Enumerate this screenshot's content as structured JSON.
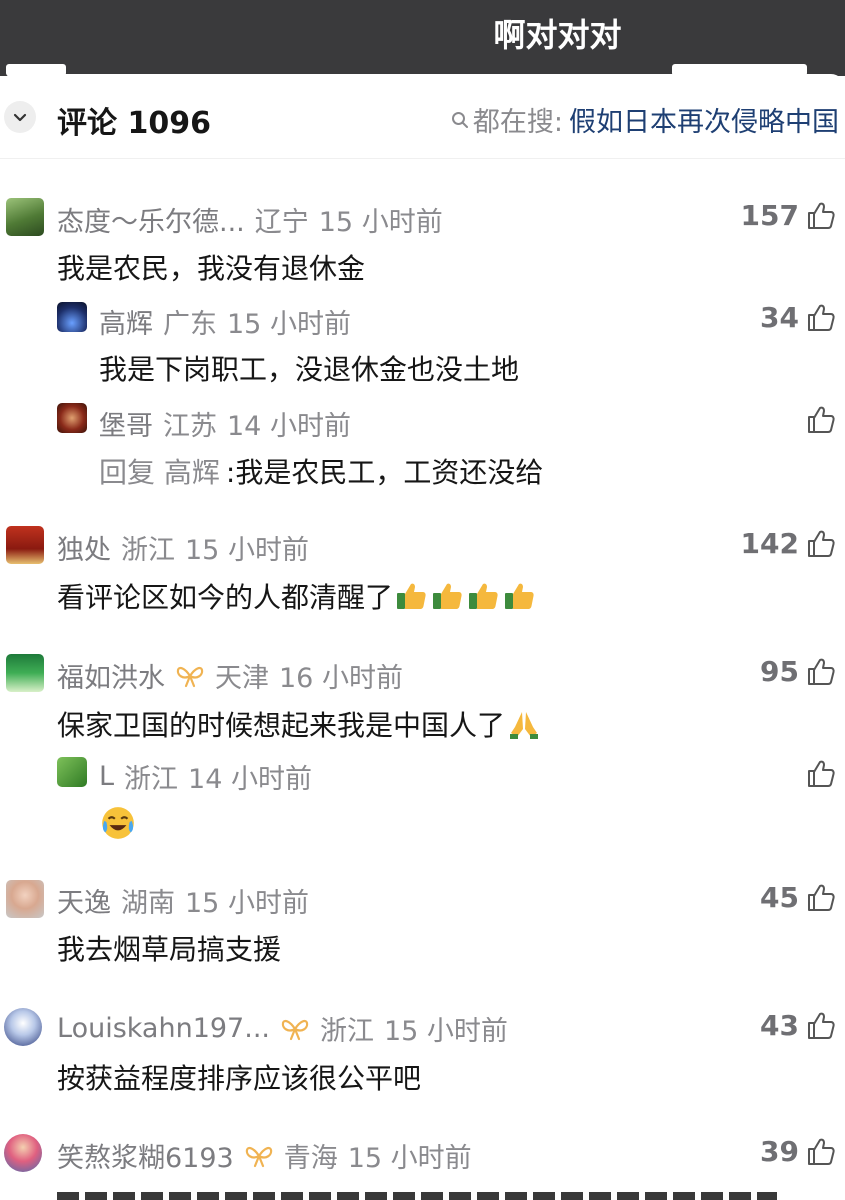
{
  "header": {
    "title": "啊对对对"
  },
  "comments_header": {
    "label": "评论 1096",
    "search_prefix": "都在搜:",
    "search_query": "假如日本再次侵略中国"
  },
  "comments": [
    {
      "user": "态度～乐尔德...",
      "region": "辽宁",
      "time": "15 小时前",
      "likes": "157",
      "text": "我是农民，我没有退休金"
    },
    {
      "user": "高辉",
      "region": "广东",
      "time": "15 小时前",
      "likes": "34",
      "text": "我是下岗职工，没退休金也没土地"
    },
    {
      "user": "堡哥",
      "region": "江苏",
      "time": "14 小时前",
      "likes": "",
      "reply_to": "回复 高辉",
      "text": ":我是农民工，工资还没给"
    },
    {
      "user": "独处",
      "region": "浙江",
      "time": "15 小时前",
      "likes": "142",
      "text": "看评论区如今的人都清醒了"
    },
    {
      "user": "福如洪水",
      "region": "天津",
      "time": "16 小时前",
      "likes": "95",
      "text": "保家卫国的时候想起来我是中国人了"
    },
    {
      "user": "L",
      "region": "浙江",
      "time": "14 小时前",
      "likes": "",
      "text": ""
    },
    {
      "user": "天逸",
      "region": "湖南",
      "time": "15 小时前",
      "likes": "45",
      "text": "我去烟草局搞支援"
    },
    {
      "user": "Louiskahn197...",
      "region": "浙江",
      "time": "15 小时前",
      "likes": "43",
      "text": "按获益程度排序应该很公平吧"
    },
    {
      "user": "笑熬浆糊6193",
      "region": "青海",
      "time": "15 小时前",
      "likes": "39",
      "text": ""
    }
  ],
  "icons": {
    "like": "thumbs-up-outline-icon",
    "collapse": "chevron-down-icon",
    "search": "search-icon",
    "badge": "bow-badge-icon",
    "emoji_thumbs": "thumbs-up-emoji",
    "emoji_pray": "folded-hands-emoji",
    "emoji_laugh_cry": "laughing-crying-emoji"
  },
  "colors": {
    "search_query": "#1e3f73",
    "meta_text": "#8a8a8e",
    "badge": "#f0b352",
    "topbar": "#3a3a3c"
  }
}
